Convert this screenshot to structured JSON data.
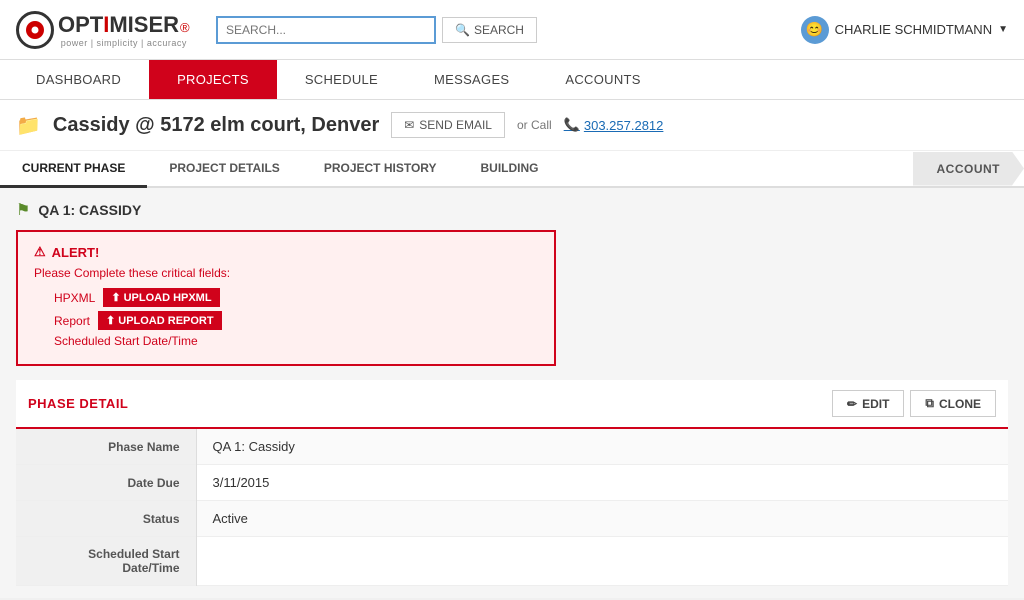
{
  "header": {
    "search_placeholder": "SEARCH...",
    "search_button_label": "SEARCH",
    "user_name": "CHARLIE SCHMIDTMANN",
    "user_avatar_icon": "smiley-icon"
  },
  "logo": {
    "text_opt": "OPT",
    "text_imiser": "IMISER",
    "tagline": "power | simplicity | accuracy"
  },
  "nav": {
    "items": [
      {
        "label": "DASHBOARD",
        "active": false
      },
      {
        "label": "PROJECTS",
        "active": true
      },
      {
        "label": "SCHEDULE",
        "active": false
      },
      {
        "label": "MESSAGES",
        "active": false
      },
      {
        "label": "ACCOUNTS",
        "active": false
      }
    ]
  },
  "project": {
    "title": "Cassidy @ 5172 elm court, Denver",
    "send_email_label": "SEND EMAIL",
    "or_call_label": "or Call",
    "phone": "303.257.2812",
    "folder_icon": "folder-icon"
  },
  "tabs": {
    "items": [
      {
        "label": "CURRENT PHASE",
        "active": true
      },
      {
        "label": "PROJECT DETAILS",
        "active": false
      },
      {
        "label": "PROJECT HISTORY",
        "active": false
      },
      {
        "label": "BUILDING",
        "active": false
      }
    ],
    "arrow_label": "ACCOUNT"
  },
  "phase": {
    "flag_label": "QA 1: CASSIDY"
  },
  "alert": {
    "title": "ALERT!",
    "subtitle": "Please Complete these critical fields:",
    "fields": [
      {
        "name": "HPXML",
        "btn_label": "UPLOAD HPXML"
      },
      {
        "name": "Report",
        "btn_label": "UPLOAD REPORT"
      },
      {
        "name": "Scheduled Start Date/Time",
        "btn_label": null
      }
    ]
  },
  "phase_detail": {
    "section_title": "PHASE DETAIL",
    "edit_label": "EDIT",
    "clone_label": "CLONE",
    "rows": [
      {
        "label": "Phase Name",
        "value": "QA 1: Cassidy"
      },
      {
        "label": "Date Due",
        "value": "3/11/2015"
      },
      {
        "label": "Status",
        "value": "Active"
      },
      {
        "label": "Scheduled Start Date/Time",
        "value": ""
      }
    ]
  }
}
